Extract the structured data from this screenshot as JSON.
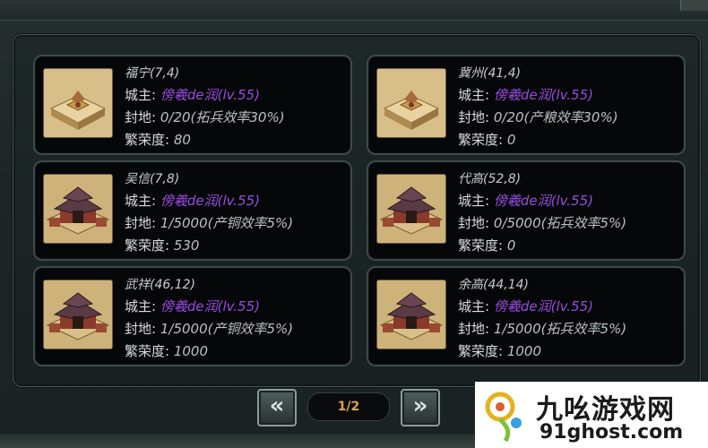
{
  "pagination": {
    "label": "1/2",
    "prev_icon": "double-chevron-left-icon",
    "next_icon": "double-chevron-right-icon"
  },
  "watermark": {
    "title": "九吆游戏网",
    "url": "91ghost.com"
  },
  "cities": [
    {
      "name": "福宁(7,4)",
      "lord_label": "城主:",
      "lord_value": "傍羲de润(lv.55)",
      "fief_label": "封地:",
      "fief_value": "0/20(拓兵效率30%)",
      "prosperity_label": "繁荣度:",
      "prosperity_value": "80",
      "thumb": "town"
    },
    {
      "name": "冀州(41,4)",
      "lord_label": "城主:",
      "lord_value": "傍羲de润(lv.55)",
      "fief_label": "封地:",
      "fief_value": "0/20(产粮效率30%)",
      "prosperity_label": "繁荣度:",
      "prosperity_value": "0",
      "thumb": "town"
    },
    {
      "name": "吴信(7,8)",
      "lord_label": "城主:",
      "lord_value": "傍羲de润(lv.55)",
      "fief_label": "封地:",
      "fief_value": "1/5000(产铜效率5%)",
      "prosperity_label": "繁荣度:",
      "prosperity_value": "530",
      "thumb": "palace"
    },
    {
      "name": "代高(52,8)",
      "lord_label": "城主:",
      "lord_value": "傍羲de润(lv.55)",
      "fief_label": "封地:",
      "fief_value": "0/5000(拓兵效率5%)",
      "prosperity_label": "繁荣度:",
      "prosperity_value": "0",
      "thumb": "palace"
    },
    {
      "name": "武祥(46,12)",
      "lord_label": "城主:",
      "lord_value": "傍羲de润(lv.55)",
      "fief_label": "封地:",
      "fief_value": "1/5000(产铜效率5%)",
      "prosperity_label": "繁荣度:",
      "prosperity_value": "1000",
      "thumb": "palace"
    },
    {
      "name": "余高(44,14)",
      "lord_label": "城主:",
      "lord_value": "傍羲de润(lv.55)",
      "fief_label": "封地:",
      "fief_value": "1/5000(拓兵效率5%)",
      "prosperity_label": "繁荣度:",
      "prosperity_value": "1000",
      "thumb": "palace"
    }
  ]
}
